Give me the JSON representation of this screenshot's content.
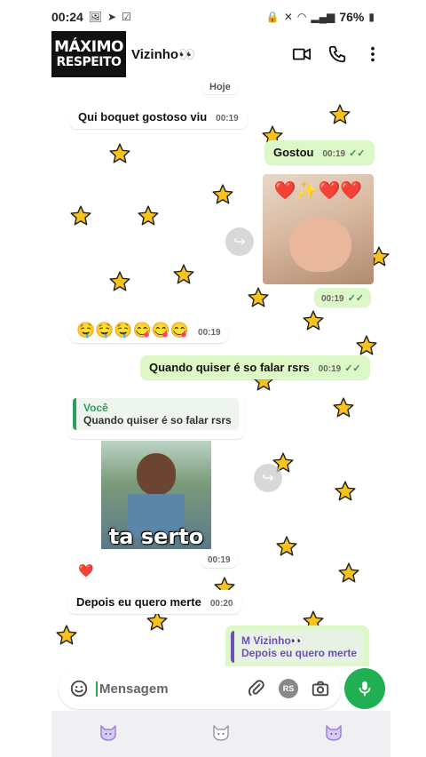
{
  "status_bar": {
    "time": "00:24",
    "battery": "76%"
  },
  "header": {
    "avatar_line1": "MÁXIMO",
    "avatar_line2": "RESPEITO",
    "contact_name": "Vizinho👀"
  },
  "chat": {
    "date_chip": "Hoje",
    "messages": [
      {
        "dir": "in",
        "text": "Qui boquet gostoso viu",
        "time": "00:19"
      },
      {
        "dir": "out",
        "text": "Gostou",
        "time": "00:19",
        "ticks": "✓✓"
      },
      {
        "dir": "out",
        "kind": "sticker",
        "emoji": "❤️✨❤️❤️",
        "time": "00:19",
        "ticks": "✓✓"
      },
      {
        "dir": "in",
        "text": "🤤🤤🤤😋😋😋",
        "time": "00:19"
      },
      {
        "dir": "out",
        "text": "Quando quiser é so falar rsrs",
        "time": "00:19",
        "ticks": "✓✓"
      },
      {
        "dir": "in",
        "kind": "reply",
        "quote_author": "Você",
        "quote_text": "Quando quiser é so falar rsrs"
      },
      {
        "dir": "in",
        "kind": "sticker",
        "caption": "ta serto",
        "time": "00:19"
      },
      {
        "dir": "in",
        "reaction": "❤️"
      },
      {
        "dir": "in",
        "text": "Depois eu quero merte",
        "time": "00:20"
      },
      {
        "dir": "out",
        "kind": "reply",
        "quote_author": "M Vizinho👀",
        "quote_text": "Depois eu quero merte"
      }
    ]
  },
  "composer": {
    "placeholder": "Mensagem",
    "rs_label": "RS"
  },
  "colors": {
    "outgoing_bubble": "#dcf8c6",
    "accent_green": "#20b053",
    "star_fill": "#f7c21e",
    "quote_purple": "#6a4fb8"
  }
}
